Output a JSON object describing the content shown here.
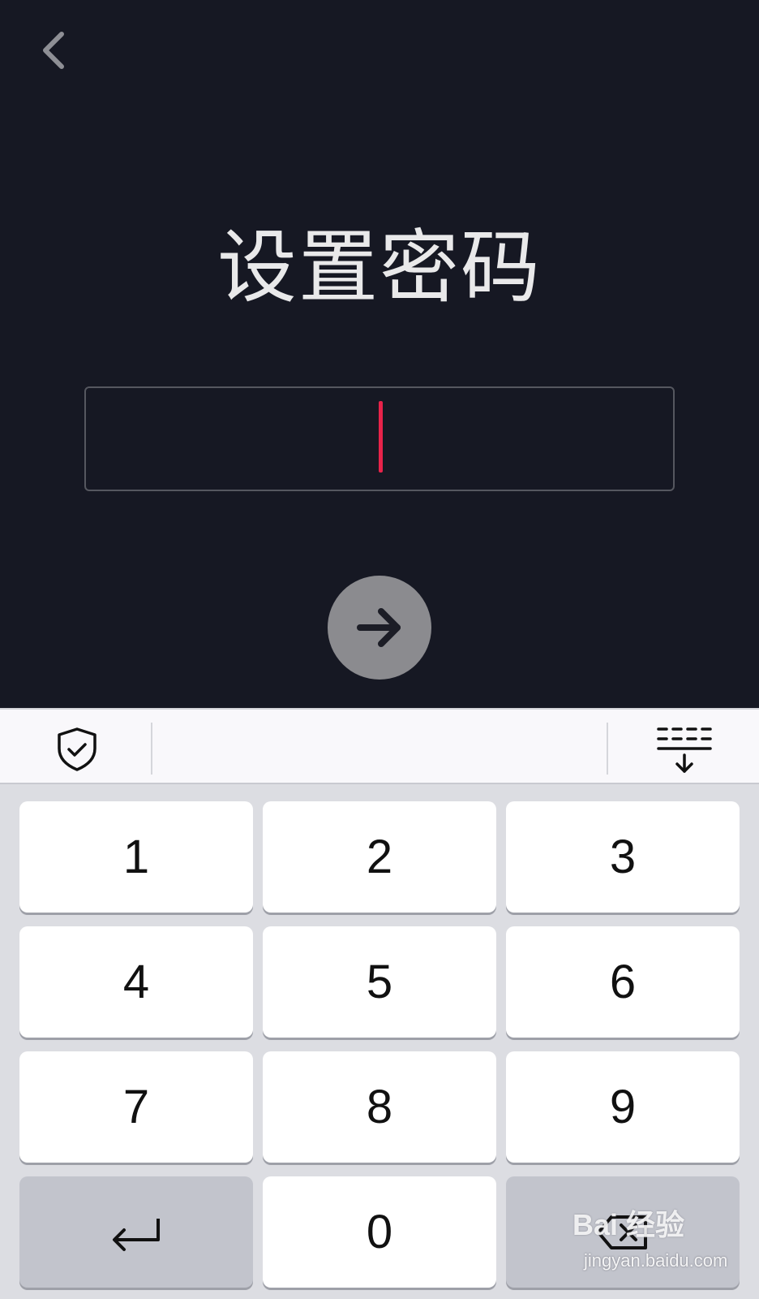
{
  "header": {
    "back_icon": "chevron-left-icon"
  },
  "title": "设置密码",
  "password_field": {
    "value": "",
    "placeholder": ""
  },
  "next_button": {
    "icon": "arrow-right-icon"
  },
  "keyboard_toolbar": {
    "left_icon": "shield-check-icon",
    "right_icon": "keyboard-hide-icon"
  },
  "keypad": {
    "keys": [
      "1",
      "2",
      "3",
      "4",
      "5",
      "6",
      "7",
      "8",
      "9",
      "0"
    ],
    "enter_icon": "return-icon",
    "delete_icon": "backspace-icon"
  },
  "watermark": {
    "brand": "Bai 经验",
    "url": "jingyan.baidu.com"
  },
  "colors": {
    "background": "#161823",
    "caret": "#e8234a",
    "next_button": "#8b8b8f",
    "keyboard_bg": "#dcdde2",
    "key_bg": "#ffffff",
    "function_key_bg": "#c2c4cc"
  }
}
